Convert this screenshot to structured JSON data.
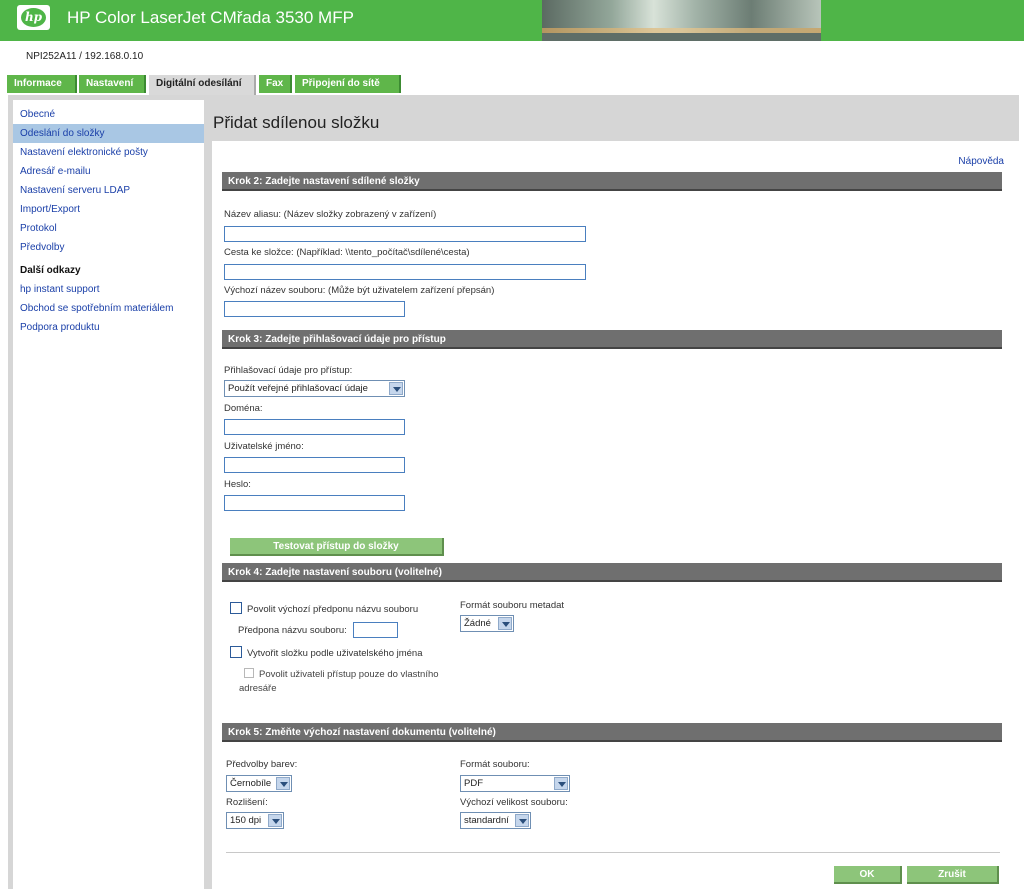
{
  "header": {
    "logo_text": "hp",
    "product_title": "HP Color LaserJet CMřada 3530 MFP",
    "device_id": "NPI252A11 / 192.168.0.10"
  },
  "tabs": [
    {
      "label": "Informace",
      "active": false
    },
    {
      "label": "Nastavení",
      "active": false
    },
    {
      "label": "Digitální odesílání",
      "active": true
    },
    {
      "label": "Fax",
      "active": false
    },
    {
      "label": "Připojení do sítě",
      "active": false
    }
  ],
  "sidebar": {
    "items": [
      {
        "label": "Obecné",
        "active": false
      },
      {
        "label": "Odeslání do složky",
        "active": true
      },
      {
        "label": "Nastavení elektronické pošty",
        "active": false
      },
      {
        "label": "Adresář e-mailu",
        "active": false
      },
      {
        "label": "Nastavení serveru LDAP",
        "active": false
      },
      {
        "label": "Import/Export",
        "active": false
      },
      {
        "label": "Protokol",
        "active": false
      },
      {
        "label": "Předvolby",
        "active": false
      }
    ],
    "links_heading": "Další odkazy",
    "links": [
      {
        "label": "hp instant support"
      },
      {
        "label": "Obchod se spotřebním materiálem"
      },
      {
        "label": "Podpora produktu"
      }
    ]
  },
  "main": {
    "title": "Přidat sdílenou složku",
    "help_link": "Nápověda",
    "step2": {
      "heading": "Krok 2: Zadejte nastavení sdílené složky",
      "alias_label": "Název aliasu: (Název složky zobrazený v zařízení)",
      "alias_value": "",
      "path_label": "Cesta ke složce: (Například: \\\\tento_počítač\\sdílené\\cesta)",
      "path_value": "",
      "filename_label": "Výchozí název souboru: (Může být uživatelem zařízení přepsán)",
      "filename_value": ""
    },
    "step3": {
      "heading": "Krok 3: Zadejte přihlašovací údaje pro přístup",
      "credentials_label": "Přihlašovací údaje pro přístup:",
      "credentials_value": "Použít veřejné přihlašovací údaje",
      "domain_label": "Doména:",
      "domain_value": "",
      "username_label": "Uživatelské jméno:",
      "username_value": "",
      "password_label": "Heslo:",
      "password_value": "",
      "test_button": "Testovat přístup do složky"
    },
    "step4": {
      "heading": "Krok 4: Zadejte nastavení souboru (volitelné)",
      "prefix_checkbox_label": "Povolit výchozí předponu názvu souboru",
      "prefix_checked": false,
      "prefix_label": "Předpona názvu souboru:",
      "prefix_value": "",
      "user_folder_label": "Vytvořit složku podle uživatelského jména",
      "user_folder_checked": false,
      "restrict_label_line1": "Povolit uživateli přístup pouze do vlastního",
      "restrict_label_line2": "adresáře",
      "restrict_checked": false,
      "metadata_label": "Formát souboru metadat",
      "metadata_value": "Žádné"
    },
    "step5": {
      "heading": "Krok 5: Změňte výchozí nastavení dokumentu (volitelné)",
      "color_label": "Předvolby barev:",
      "color_value": "Černobíle",
      "resolution_label": "Rozlišení:",
      "resolution_value": "150 dpi",
      "format_label": "Formát souboru:",
      "format_value": "PDF",
      "size_label": "Výchozí velikost souboru:",
      "size_value": "standardní"
    },
    "ok_button": "OK",
    "cancel_button": "Zrušit"
  },
  "colors": {
    "header_green": "#4fb548",
    "tab_green": "#5fb64a",
    "section_gray": "#6f6f6f",
    "link_blue": "#1a3fa8",
    "active_nav": "#a9c7e4",
    "button_green": "#8dc57a"
  }
}
